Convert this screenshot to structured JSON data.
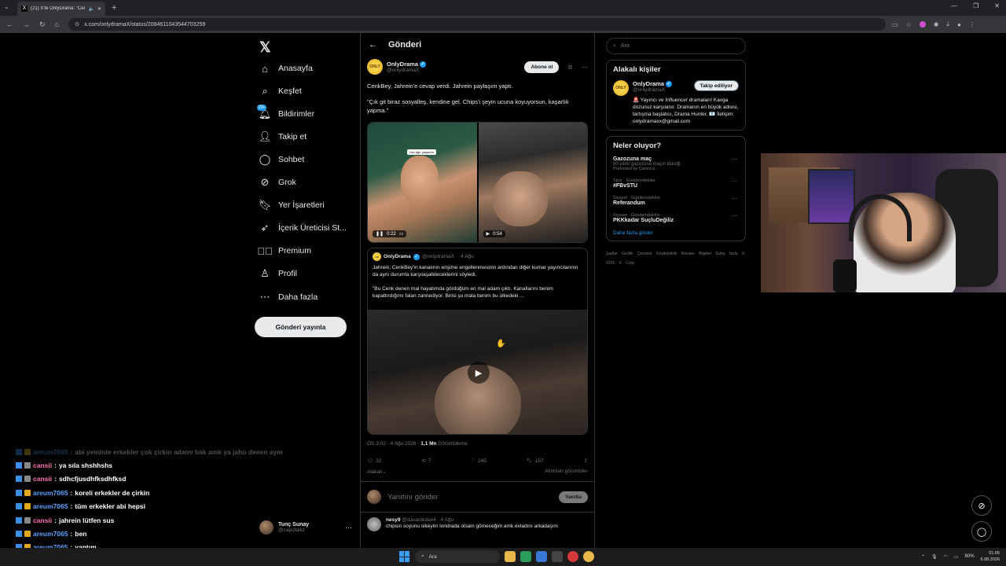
{
  "browser": {
    "tab_title": "(21) X'te OnlyDrama: \"Cenk...",
    "url": "x.com/onlydramaX/status/2084611043544703259"
  },
  "nav": {
    "items": [
      {
        "label": "Anasayfa",
        "icon": "home-icon"
      },
      {
        "label": "Keşfet",
        "icon": "search-icon"
      },
      {
        "label": "Bildirimler",
        "icon": "bell-icon",
        "badge": "20+"
      },
      {
        "label": "Takip et",
        "icon": "person-add-icon"
      },
      {
        "label": "Sohbet",
        "icon": "chat-icon"
      },
      {
        "label": "Grok",
        "icon": "grok-icon"
      },
      {
        "label": "Yer İşaretleri",
        "icon": "bookmark-icon"
      },
      {
        "label": "İçerik Üreticisi St...",
        "icon": "rocket-icon"
      },
      {
        "label": "Premium",
        "icon": "premium-icon"
      },
      {
        "label": "Profil",
        "icon": "profile-icon"
      },
      {
        "label": "Daha fazla",
        "icon": "more-icon"
      }
    ],
    "post_button": "Gönderi yayınla",
    "account": {
      "name": "Tunç Sunay",
      "handle": "@capotalkz"
    }
  },
  "main": {
    "header_title": "Gönderi",
    "tweet": {
      "author": "OnlyDrama",
      "handle": "@onlydramaX",
      "subscribe": "Abone ol",
      "text1": "CenkBey, Jahrein'e cevap verdi. Jahrein paylaşım yaptı.",
      "text2": "\"Çık git biraz sosyalleş, kendine gel. Chips'i şeyin ucuna koyuyorsun, kaşarlık yapma.\"",
      "video1_time": "0:22",
      "video2_time": "0:54",
      "video1_caption": "Lan ağır yaşadım",
      "quote": {
        "author": "OnlyDrama",
        "handle": "@onlydramaX",
        "date": "4 Ağu",
        "text1": "Jahrein, CenkBey'in kanalının erişime engellenmesinin ardından diğer kumar yayıncılarının da aynı durumla karşılaşabileceklerini söyledi.",
        "text2": "\"Bu Cenk denen mal hayatımda gördüğüm en mal adam çıktı. Kanallarını benim kapattırdığımı falan zannediyor. Birisi şu mala benim bu ülkedeki ..."
      },
      "meta_time": "ÖS 3:02 · 4 Ağu 2026 · ",
      "views": "1,1 Mn",
      "views_label": " Görüntüleme",
      "replies": "32",
      "retweets": "7",
      "likes": "245",
      "bookmarks": "157",
      "relevant": "Alakalı",
      "quotes_link": "Alıntıları görüntüle"
    },
    "reply_placeholder": "Yanıtını gönder",
    "reply_button": "Yanıtla",
    "comment": {
      "author": "nesy9",
      "handle": "@davardiolax4",
      "date": "4 Ağu",
      "text": "chipsin soyunu sikeyim londrada olsam gömeceğim amk evladını arkadaşım"
    }
  },
  "right": {
    "search_placeholder": "Ara",
    "related_title": "Alakalı kişiler",
    "related": {
      "name": "OnlyDrama",
      "handle": "@onlydramaX",
      "button": "Takip ediliyor",
      "bio": "🚨 Yayıncı ve Influencer dramaları! Kavga dozunuz karşılanır. Dramanın en büyük adresi, tartışma başlatıcı, Drama Hunter. 📧 İletişim: onlydramaxx@gmail.com"
    },
    "trends_title": "Neler oluyor?",
    "trends": [
      {
        "cat": "",
        "title": "Gazozuna maç",
        "desc": "80 yıldır gazozuna maçın klasiği.",
        "promo": "Promoted by Çamlıca"
      },
      {
        "cat": "Spor · Gündemdekiler",
        "title": "#FBvSTU",
        "desc": "",
        "promo": ""
      },
      {
        "cat": "Siyaset · Gündemdekiler",
        "title": "Referandum",
        "desc": "",
        "promo": ""
      },
      {
        "cat": "Siyaset · Gündemdekiler",
        "title": "PKKkadar SuçluDeğiliz",
        "desc": "",
        "promo": ""
      }
    ],
    "show_more": "Daha fazla göster",
    "footer": "Şartlar   Gizlilik   Çerezler   Erişilebilirlik   Reklam Bilgileri   Daha fazla   © 2026 X Corp."
  },
  "chat": [
    {
      "user": "areum7065",
      "color": "#5aa0ff",
      "msg": "abi yeminle erkekler çok çirkin adamı bak amk ya jaho deeen aym",
      "faded": true,
      "gold": true
    },
    {
      "user": "cansii",
      "color": "#ff6fb5",
      "msg": "ya sıla shshhshs",
      "faded": false,
      "gold": false
    },
    {
      "user": "cansii",
      "color": "#ff6fb5",
      "msg": "sdhcfjusdhfksdhfksd",
      "faded": false,
      "gold": false
    },
    {
      "user": "areum7065",
      "color": "#5aa0ff",
      "msg": "koreli erkekler de çirkin",
      "faded": false,
      "gold": true
    },
    {
      "user": "areum7065",
      "color": "#5aa0ff",
      "msg": "tüm erkekler abi hepsi",
      "faded": false,
      "gold": true
    },
    {
      "user": "cansii",
      "color": "#ff6fb5",
      "msg": "jahrein lütfen sus",
      "faded": false,
      "gold": false
    },
    {
      "user": "areum7065",
      "color": "#5aa0ff",
      "msg": "ben",
      "faded": false,
      "gold": true
    },
    {
      "user": "areum7065",
      "color": "#5aa0ff",
      "msg": "yaptım",
      "faded": false,
      "gold": true
    }
  ],
  "taskbar": {
    "search": "Ara",
    "battery": "80%",
    "time": "01:05",
    "date": "6.08.2026"
  }
}
